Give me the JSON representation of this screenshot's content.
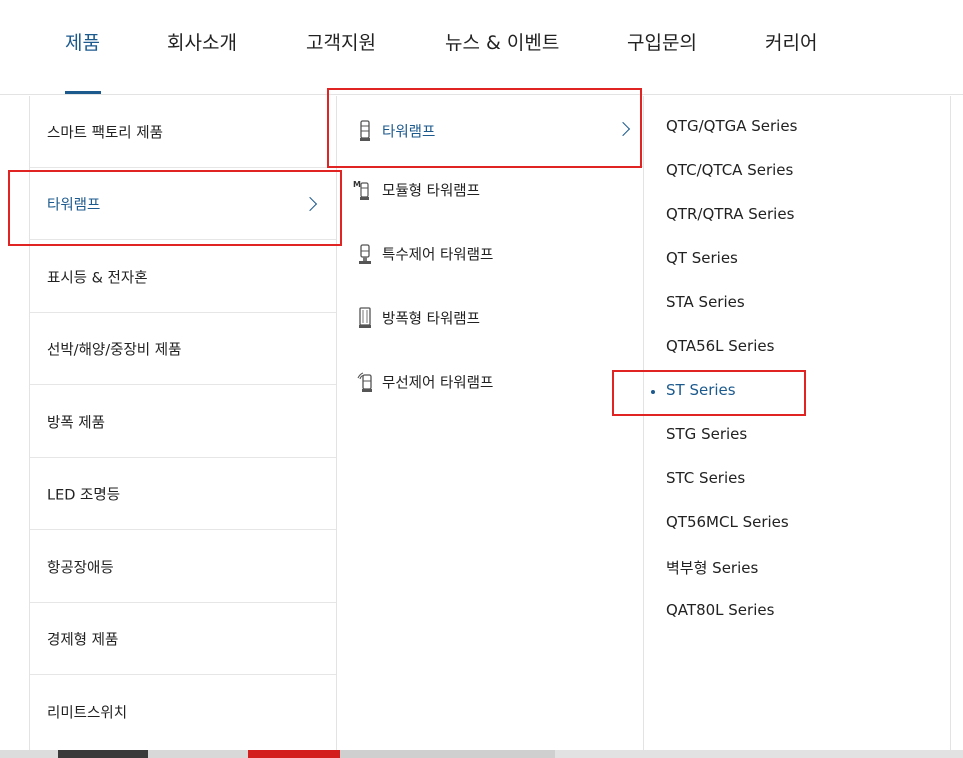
{
  "nav": {
    "tabs": [
      {
        "label": "제품",
        "active": true
      },
      {
        "label": "회사소개",
        "active": false
      },
      {
        "label": "고객지원",
        "active": false
      },
      {
        "label": "뉴스 & 이벤트",
        "active": false
      },
      {
        "label": "구입문의",
        "active": false
      },
      {
        "label": "커리어",
        "active": false
      }
    ]
  },
  "categories": [
    {
      "label": "스마트 팩토리 제품"
    },
    {
      "label": "타워램프",
      "active": true
    },
    {
      "label": "표시등 & 전자혼"
    },
    {
      "label": "선박/해양/중장비 제품"
    },
    {
      "label": "방폭 제품"
    },
    {
      "label": "LED 조명등"
    },
    {
      "label": "항공장애등"
    },
    {
      "label": "경제형 제품"
    },
    {
      "label": "리미트스위치"
    }
  ],
  "subcategories": [
    {
      "label": "타워램프",
      "icon": "tower-lamp-icon",
      "active": true
    },
    {
      "label": "모듈형 타워램프",
      "icon": "modular-tower-lamp-icon",
      "badge": "M"
    },
    {
      "label": "특수제어 타워램프",
      "icon": "special-control-tower-lamp-icon"
    },
    {
      "label": "방폭형 타워램프",
      "icon": "explosion-proof-tower-lamp-icon"
    },
    {
      "label": "무선제어 타워램프",
      "icon": "wireless-tower-lamp-icon"
    }
  ],
  "series": [
    {
      "label": "QTG/QTGA Series"
    },
    {
      "label": "QTC/QTCA Series"
    },
    {
      "label": "QTR/QTRA Series"
    },
    {
      "label": "QT Series"
    },
    {
      "label": "STA Series"
    },
    {
      "label": "QTA56L Series"
    },
    {
      "label": "ST Series",
      "active": true
    },
    {
      "label": "STG Series"
    },
    {
      "label": "STC Series"
    },
    {
      "label": "QT56MCL Series"
    },
    {
      "label": "벽부형 Series"
    },
    {
      "label": "QAT80L Series"
    }
  ],
  "colors": {
    "accent": "#1c5a8e",
    "highlight": "#e02424",
    "divider": "#e3e3e3"
  }
}
